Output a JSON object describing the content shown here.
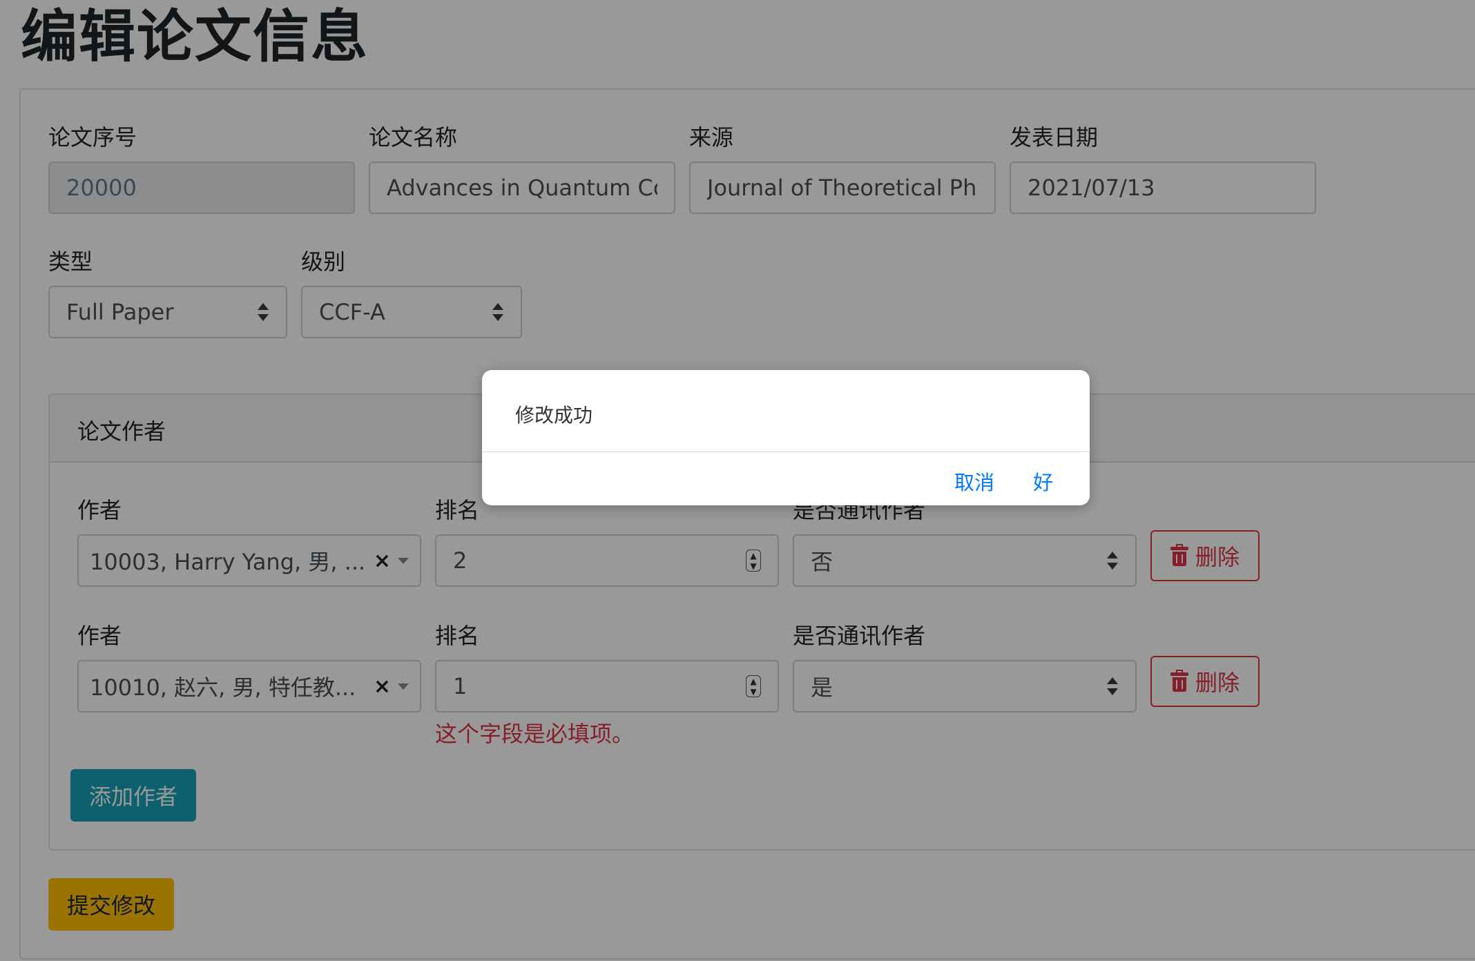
{
  "page": {
    "title": "编辑论文信息"
  },
  "paper": {
    "id_label": "论文序号",
    "id_value": "20000",
    "name_label": "论文名称",
    "name_value": "Advances in Quantum Com",
    "source_label": "来源",
    "source_value": "Journal of Theoretical Phys",
    "date_label": "发表日期",
    "date_value": "2021/07/13",
    "type_label": "类型",
    "type_value": "Full Paper",
    "level_label": "级别",
    "level_value": "CCF-A"
  },
  "authors_section": {
    "header": "论文作者",
    "author_label": "作者",
    "rank_label": "排名",
    "corresponding_label": "是否通讯作者",
    "delete_label": "删除",
    "rows": [
      {
        "author": "10003, Harry Yang, 男, ...",
        "rank": "2",
        "corresponding": "否"
      },
      {
        "author": "10010, 赵六, 男, 特任教...",
        "rank": "1",
        "corresponding": "是"
      }
    ],
    "rank_error": "这个字段是必填项。",
    "add_button": "添加作者"
  },
  "submit_button": "提交修改",
  "dialog": {
    "message": "修改成功",
    "cancel": "取消",
    "ok": "好"
  },
  "icons": {
    "clear": "×",
    "trash": "trash-icon"
  },
  "colors": {
    "danger": "#dc3545",
    "info": "#17a2b8",
    "warning": "#ffc107",
    "link": "#007bff"
  }
}
